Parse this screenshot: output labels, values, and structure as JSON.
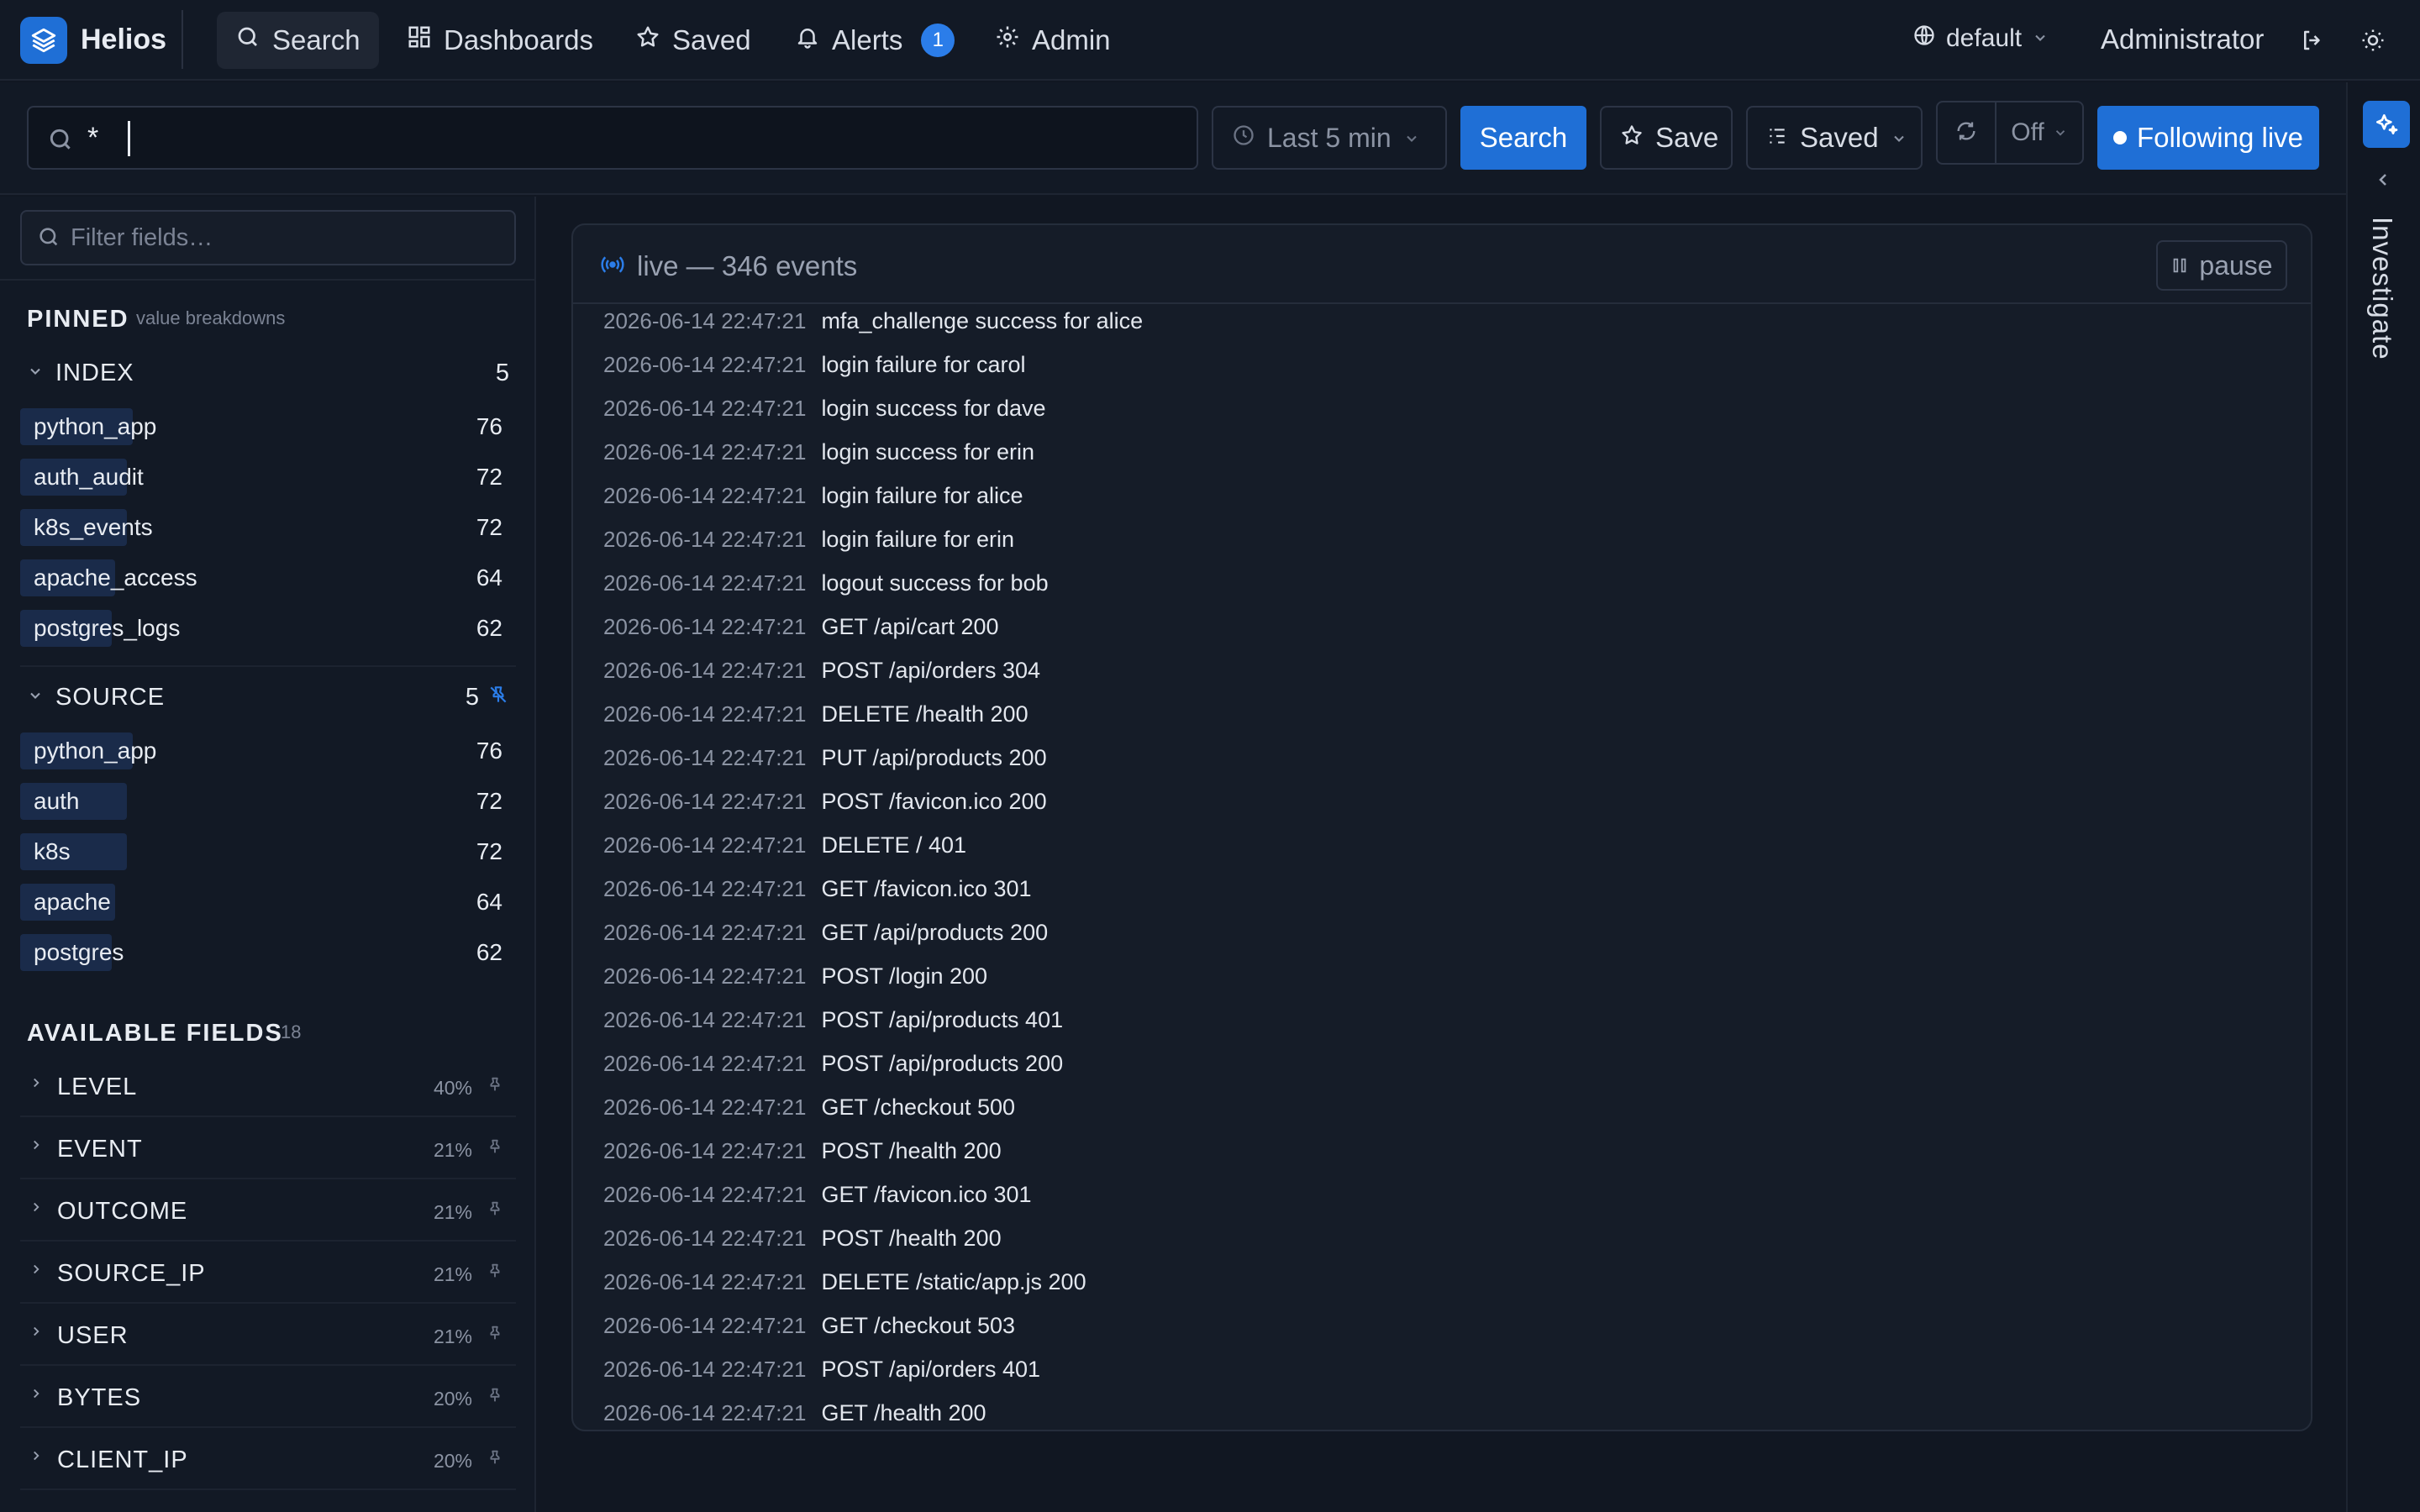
{
  "app": {
    "brand": "Helios"
  },
  "nav": [
    {
      "label": "Search"
    },
    {
      "label": "Dashboards"
    },
    {
      "label": "Saved"
    },
    {
      "label": "Alerts",
      "badge": "1"
    },
    {
      "label": "Admin"
    }
  ],
  "header": {
    "tenant": "default",
    "user": "Administrator"
  },
  "searchbar": {
    "query": "*",
    "time_range": "Last 5 min",
    "search_label": "Search",
    "save_label": "Save",
    "saved_label": "Saved",
    "refresh_value": "Off",
    "live_label": "Following live"
  },
  "rail": {
    "label": "Investigate"
  },
  "sidebar": {
    "filter_placeholder": "Filter fields…",
    "pinned_title": "PINNED",
    "pinned_sub": "value breakdowns",
    "groups": [
      {
        "name": "INDEX",
        "count": "5",
        "values": [
          {
            "label": "python_app",
            "count": "76",
            "ratio": 1.0
          },
          {
            "label": "auth_audit",
            "count": "72",
            "ratio": 0.9474
          },
          {
            "label": "k8s_events",
            "count": "72",
            "ratio": 0.9474
          },
          {
            "label": "apache_access",
            "count": "64",
            "ratio": 0.8421
          },
          {
            "label": "postgres_logs",
            "count": "62",
            "ratio": 0.8158
          }
        ]
      },
      {
        "name": "SOURCE",
        "count": "5",
        "values": [
          {
            "label": "python_app",
            "count": "76",
            "ratio": 1.0
          },
          {
            "label": "auth",
            "count": "72",
            "ratio": 0.9474
          },
          {
            "label": "k8s",
            "count": "72",
            "ratio": 0.9474
          },
          {
            "label": "apache",
            "count": "64",
            "ratio": 0.8421
          },
          {
            "label": "postgres",
            "count": "62",
            "ratio": 0.8158
          }
        ]
      }
    ],
    "available_title": "AVAILABLE FIELDS",
    "available_count": "18",
    "fields": [
      {
        "name": "LEVEL",
        "pct": "40%"
      },
      {
        "name": "EVENT",
        "pct": "21%"
      },
      {
        "name": "OUTCOME",
        "pct": "21%"
      },
      {
        "name": "SOURCE_IP",
        "pct": "21%"
      },
      {
        "name": "USER",
        "pct": "21%"
      },
      {
        "name": "BYTES",
        "pct": "20%"
      },
      {
        "name": "CLIENT_IP",
        "pct": "20%"
      }
    ]
  },
  "events": {
    "title": "live — 346 events",
    "pause_label": "pause",
    "rows": [
      {
        "time": "2026-06-14 22:47:21",
        "message": "mfa_challenge success for alice"
      },
      {
        "time": "2026-06-14 22:47:21",
        "message": "login failure for carol"
      },
      {
        "time": "2026-06-14 22:47:21",
        "message": "login success for dave"
      },
      {
        "time": "2026-06-14 22:47:21",
        "message": "login success for erin"
      },
      {
        "time": "2026-06-14 22:47:21",
        "message": "login failure for alice"
      },
      {
        "time": "2026-06-14 22:47:21",
        "message": "login failure for erin"
      },
      {
        "time": "2026-06-14 22:47:21",
        "message": "logout success for bob"
      },
      {
        "time": "2026-06-14 22:47:21",
        "message": "GET /api/cart 200"
      },
      {
        "time": "2026-06-14 22:47:21",
        "message": "POST /api/orders 304"
      },
      {
        "time": "2026-06-14 22:47:21",
        "message": "DELETE /health 200"
      },
      {
        "time": "2026-06-14 22:47:21",
        "message": "PUT /api/products 200"
      },
      {
        "time": "2026-06-14 22:47:21",
        "message": "POST /favicon.ico 200"
      },
      {
        "time": "2026-06-14 22:47:21",
        "message": "DELETE / 401"
      },
      {
        "time": "2026-06-14 22:47:21",
        "message": "GET /favicon.ico 301"
      },
      {
        "time": "2026-06-14 22:47:21",
        "message": "GET /api/products 200"
      },
      {
        "time": "2026-06-14 22:47:21",
        "message": "POST /login 200"
      },
      {
        "time": "2026-06-14 22:47:21",
        "message": "POST /api/products 401"
      },
      {
        "time": "2026-06-14 22:47:21",
        "message": "POST /api/products 200"
      },
      {
        "time": "2026-06-14 22:47:21",
        "message": "GET /checkout 500"
      },
      {
        "time": "2026-06-14 22:47:21",
        "message": "POST /health 200"
      },
      {
        "time": "2026-06-14 22:47:21",
        "message": "GET /favicon.ico 301"
      },
      {
        "time": "2026-06-14 22:47:21",
        "message": "POST /health 200"
      },
      {
        "time": "2026-06-14 22:47:21",
        "message": "DELETE /static/app.js 200"
      },
      {
        "time": "2026-06-14 22:47:21",
        "message": "GET /checkout 503"
      },
      {
        "time": "2026-06-14 22:47:21",
        "message": "POST /api/orders 401"
      },
      {
        "time": "2026-06-14 22:47:21",
        "message": "GET /health 200"
      }
    ]
  },
  "colors": {
    "accent": "#1f6fd6",
    "bar": "#1a2b4a",
    "background": "#111722"
  },
  "icons": [
    "layers-icon",
    "search-icon",
    "grid-icon",
    "star-icon",
    "bell-icon",
    "gear-icon",
    "globe-icon",
    "logout-icon",
    "sun-icon",
    "clock-icon",
    "refresh-icon",
    "sparkle-icon",
    "broadcast-icon",
    "pause-icon",
    "pin-icon",
    "unpin-icon"
  ]
}
